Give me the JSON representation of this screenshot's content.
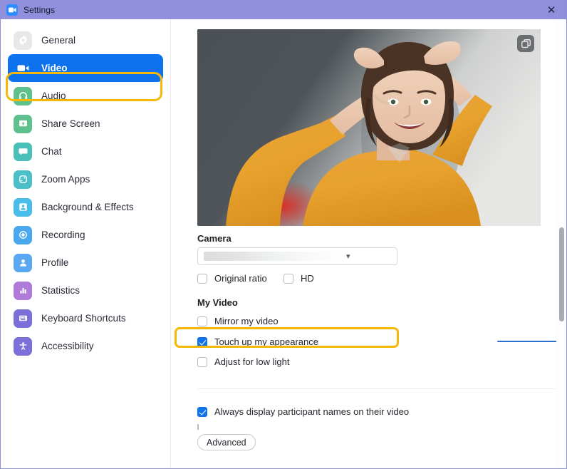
{
  "window": {
    "title": "Settings",
    "app_icon": "video-camera-icon",
    "close_label": "✕"
  },
  "sidebar": {
    "items": [
      {
        "label": "General",
        "icon": "gear-icon",
        "icon_bg": "#e8e8e8",
        "selected": false
      },
      {
        "label": "Video",
        "icon": "video-camera-icon",
        "icon_bg": "#0e72ed",
        "selected": true
      },
      {
        "label": "Audio",
        "icon": "headphones-icon",
        "icon_bg": "#5ec08a",
        "selected": false
      },
      {
        "label": "Share Screen",
        "icon": "share-screen-icon",
        "icon_bg": "#5ec08a",
        "selected": false
      },
      {
        "label": "Chat",
        "icon": "chat-bubble-icon",
        "icon_bg": "#4bc0b8",
        "selected": false
      },
      {
        "label": "Zoom Apps",
        "icon": "zoom-apps-icon",
        "icon_bg": "#4bc0c8",
        "selected": false
      },
      {
        "label": "Background & Effects",
        "icon": "background-effects-icon",
        "icon_bg": "#48bdea",
        "selected": false
      },
      {
        "label": "Recording",
        "icon": "record-icon",
        "icon_bg": "#4aa8ef",
        "selected": false
      },
      {
        "label": "Profile",
        "icon": "person-icon",
        "icon_bg": "#5aa8f0",
        "selected": false
      },
      {
        "label": "Statistics",
        "icon": "bar-chart-icon",
        "icon_bg": "#b07ad8",
        "selected": false
      },
      {
        "label": "Keyboard Shortcuts",
        "icon": "keyboard-icon",
        "icon_bg": "#7b6fd8",
        "selected": false
      },
      {
        "label": "Accessibility",
        "icon": "accessibility-icon",
        "icon_bg": "#7b6fd8",
        "selected": false
      }
    ]
  },
  "main": {
    "preview": {
      "rotate_button_icon": "rotate-camera-icon"
    },
    "camera": {
      "title": "Camera",
      "selected_value": "",
      "caret_icon": "chevron-down-icon",
      "options": [
        {
          "label": "Original ratio",
          "checked": false
        },
        {
          "label": "HD",
          "checked": false
        }
      ]
    },
    "my_video": {
      "title": "My Video",
      "options": [
        {
          "label": "Mirror my video",
          "checked": false
        },
        {
          "label": "Touch up my appearance",
          "checked": true
        },
        {
          "label": "Adjust for low light",
          "checked": false
        }
      ],
      "touchup_slider": {
        "value": 100,
        "min": 0,
        "max": 100
      }
    },
    "participants": {
      "options": [
        {
          "label": "Always display participant names on their video",
          "checked": true
        }
      ]
    },
    "advanced_button": "Advanced"
  },
  "colors": {
    "titlebar": "#8f8fdc",
    "accent": "#0e72ed",
    "highlight": "#f5b809",
    "slider": "#1b6fd8"
  }
}
